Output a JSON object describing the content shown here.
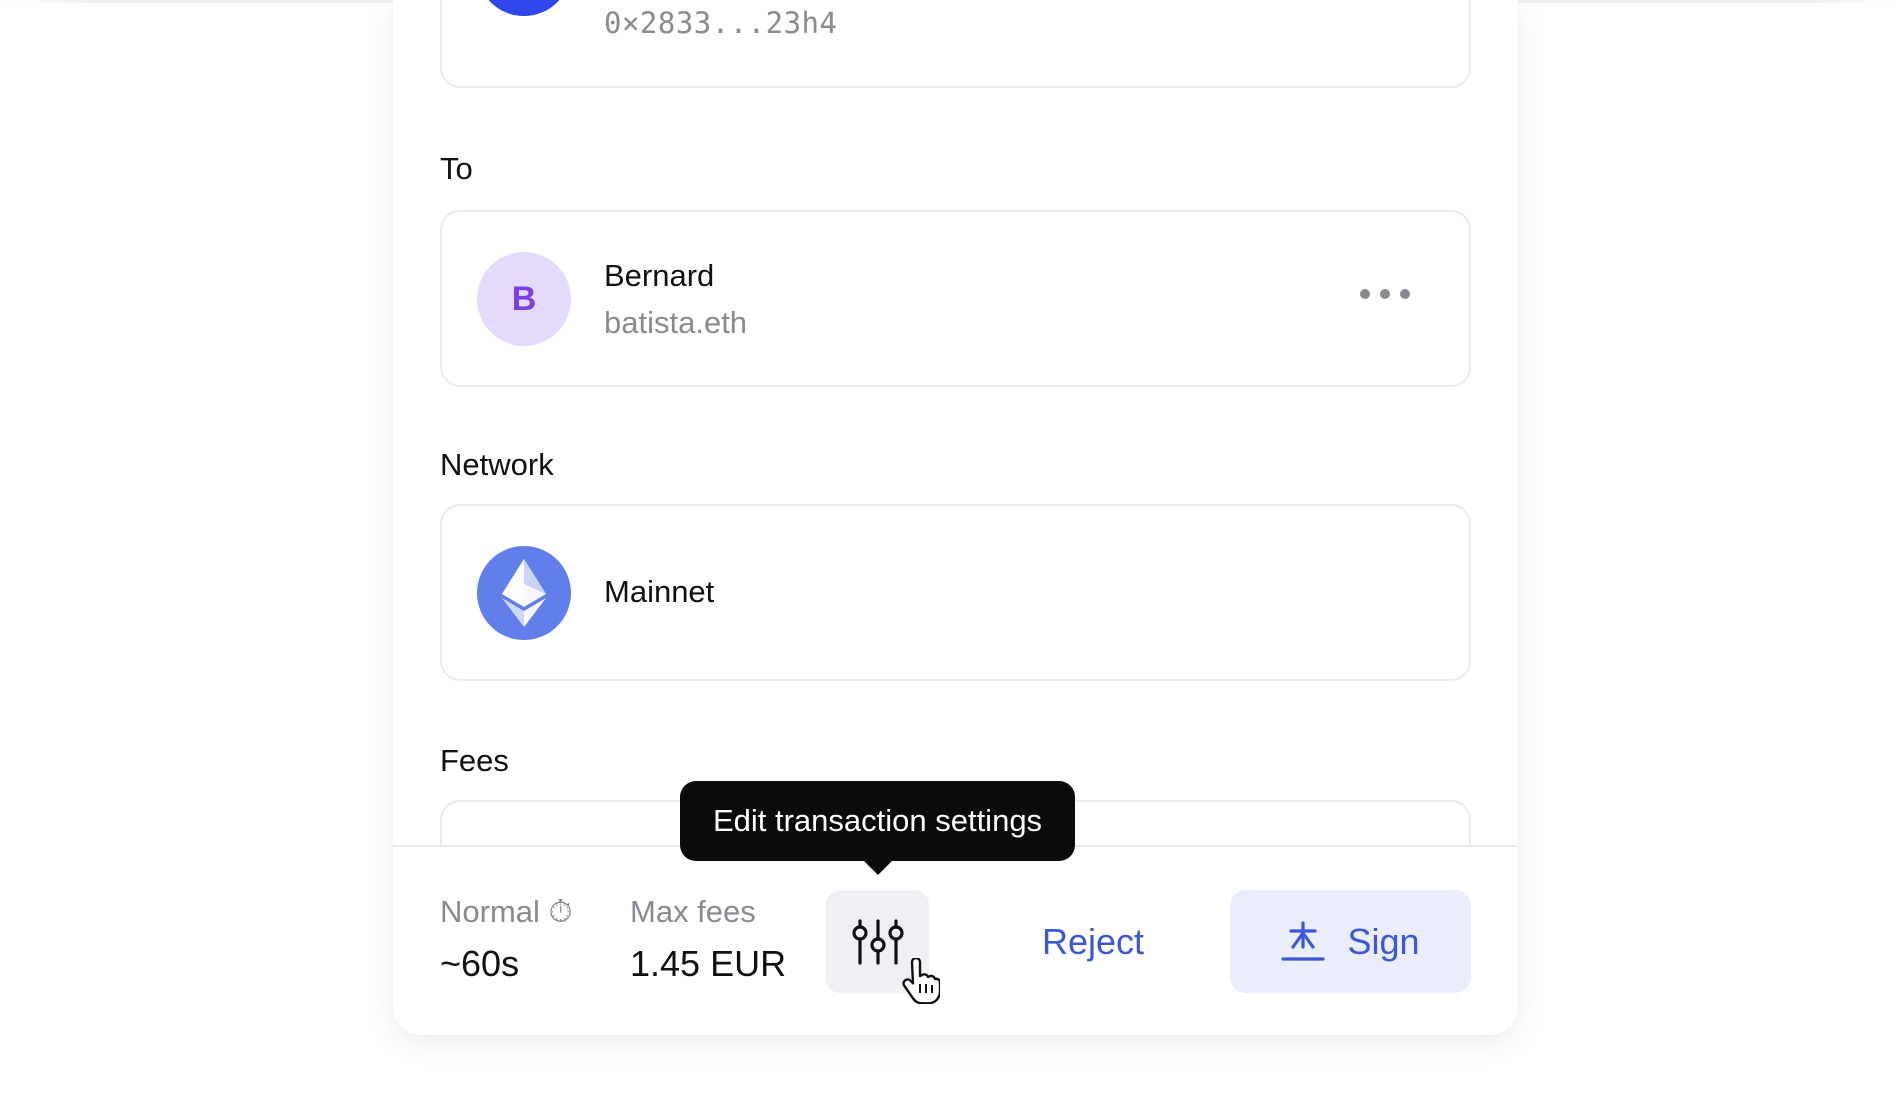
{
  "from": {
    "address": "0×2833...23h4"
  },
  "to": {
    "label": "To",
    "avatar_letter": "B",
    "name": "Bernard",
    "ens": "batista.eth",
    "menu_icon": "more-horizontal-icon"
  },
  "network": {
    "label": "Network",
    "name": "Mainnet",
    "icon": "ethereum-icon"
  },
  "fees": {
    "label": "Fees"
  },
  "footer": {
    "speed_label": "Normal ⏱",
    "speed_value": "~60s",
    "max_fees_label": "Max fees",
    "max_fees_value": "1.45 EUR",
    "settings_icon": "sliders-icon",
    "reject_label": "Reject",
    "sign_label": "Sign",
    "sign_icon": "sign-pen-icon"
  },
  "tooltip": {
    "text": "Edit transaction settings"
  },
  "colors": {
    "accent": "#3d57d9",
    "sign_bg": "#eaedfb",
    "avatar_bg": "#e4dafc",
    "avatar_letter": "#7b3fe4",
    "eth_bg": "#627eea",
    "card_border": "#ececef",
    "muted_text": "#8a8a92"
  }
}
